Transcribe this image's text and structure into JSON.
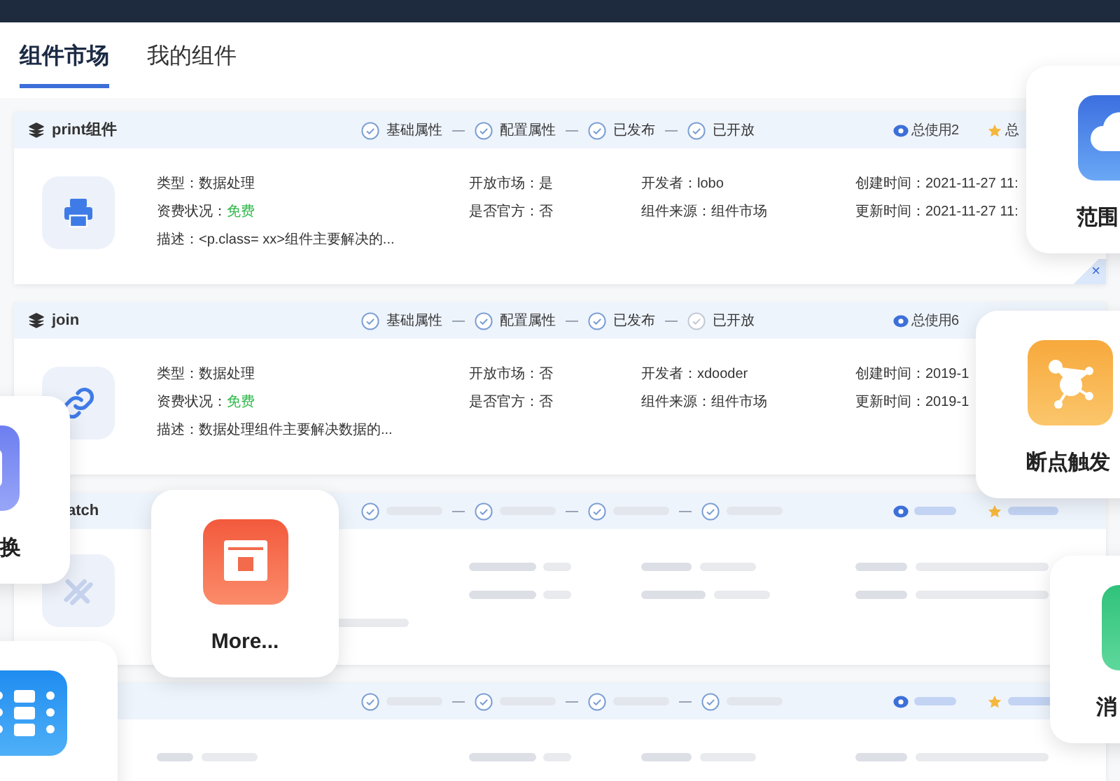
{
  "tabs": [
    {
      "label": "组件市场",
      "selected": true
    },
    {
      "label": "我的组件",
      "selected": false
    }
  ],
  "components": [
    {
      "kind": "detail",
      "name": "print组件",
      "steps": [
        {
          "label": "基础属性",
          "done": true
        },
        {
          "label": "配置属性",
          "done": true
        },
        {
          "label": "已发布",
          "done": true
        },
        {
          "label": "已开放",
          "done": true
        }
      ],
      "usage": "总使用2",
      "rating": "总",
      "type": "类型：数据处理",
      "fee_label": "资费状况：",
      "fee": "免费",
      "description": "描述：<p.class= xx>组件主要解决的...",
      "market": "开放市场：是",
      "official": "是否官方：否",
      "developer": "开发者：lobo",
      "source": "组件来源：组件市场",
      "created": "创建时间：2021-11-27 11:",
      "updated": "更新时间：2021-11-27 11:"
    },
    {
      "kind": "detail",
      "name": "join",
      "steps": [
        {
          "label": "基础属性",
          "done": true
        },
        {
          "label": "配置属性",
          "done": true
        },
        {
          "label": "已发布",
          "done": true
        },
        {
          "label": "已开放",
          "done": false
        }
      ],
      "usage": "总使用6",
      "type": "类型：数据处理",
      "fee_label": "资费状况：",
      "fee": "免费",
      "description": "描述：数据处理组件主要解决数据的...",
      "market": "开放市场：否",
      "official": "是否官方：否",
      "developer": "开发者：xdooder",
      "source": "组件来源：组件市场",
      "created": "创建时间：2019-1",
      "updated": "更新时间：2019-1"
    },
    {
      "kind": "skeleton",
      "name": "atch"
    },
    {
      "kind": "skeleton"
    }
  ],
  "tiles": [
    {
      "kind": "labeled",
      "label": "范围"
    },
    {
      "kind": "labeled",
      "label": "断点触发"
    },
    {
      "kind": "labeled",
      "label": "换"
    },
    {
      "kind": "labeled",
      "label": "More..."
    },
    {
      "kind": "icon"
    },
    {
      "kind": "labeled",
      "label": "消"
    }
  ],
  "close": "×"
}
